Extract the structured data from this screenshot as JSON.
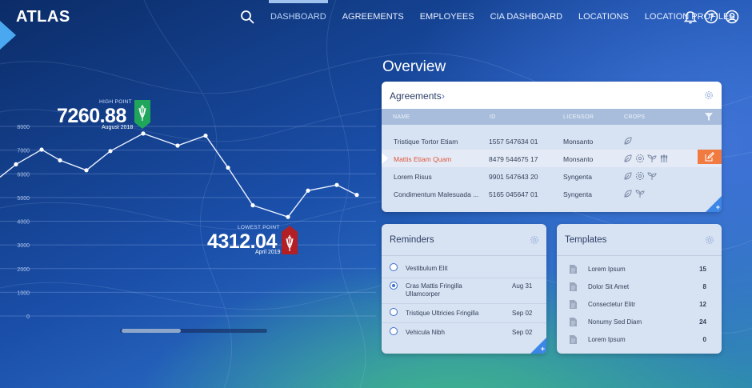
{
  "brand": {
    "name": "ATLAS",
    "accent": "#4aa8f0"
  },
  "nav": {
    "items": [
      {
        "label": "DASHBOARD",
        "active": true
      },
      {
        "label": "AGREEMENTS",
        "active": false
      },
      {
        "label": "EMPLOYEES",
        "active": false
      },
      {
        "label": "CIA DASHBOARD",
        "active": false
      },
      {
        "label": "LOCATIONS",
        "active": false
      },
      {
        "label": "LOCATION PROFILES",
        "active": false
      }
    ],
    "icons": [
      "search-icon",
      "bell-icon",
      "help-icon",
      "user-icon"
    ]
  },
  "chart_data": {
    "type": "line",
    "y_ticks": [
      "8000",
      "7000",
      "6000",
      "5000",
      "4000",
      "3000",
      "2000",
      "1000",
      "0"
    ],
    "ylim": [
      0,
      8000
    ],
    "grid": true,
    "series": [
      {
        "values": [
          6400,
          7020,
          6570,
          6150,
          6960,
          7700,
          7190,
          7610,
          6260,
          4670,
          4180,
          5290,
          5530,
          5110
        ]
      }
    ],
    "high": {
      "label": "HIGH POINT",
      "value": "7260.88",
      "date": "August 2018",
      "color": "#1fa65a"
    },
    "low": {
      "label": "LOWEST POINT",
      "value": "4312.04",
      "date": "April 2019",
      "color": "#b21f24"
    }
  },
  "overview": {
    "title": "Overview",
    "agreements": {
      "title": "Agreements",
      "columns": [
        "NAME",
        "ID",
        "LICENSOR",
        "CROPS"
      ],
      "rows": [
        {
          "name": "Tristique Tortor Etiam",
          "id": "1557 547634 01",
          "licensor": "Monsanto",
          "crops": [
            "leaf-icon"
          ],
          "selected": false
        },
        {
          "name": "Mattis Etiam Quam",
          "id": "8479 544675 17",
          "licensor": "Monsanto",
          "crops": [
            "leaf-icon",
            "flower-icon",
            "sprout-icon",
            "wheat-icon"
          ],
          "selected": true
        },
        {
          "name": "Lorem Risus",
          "id": "9901 547643 20",
          "licensor": "Syngenta",
          "crops": [
            "leaf-icon",
            "flower-icon",
            "sprout-icon"
          ],
          "selected": false
        },
        {
          "name": "Condimentum Malesuada ...",
          "id": "5165 045647 01",
          "licensor": "Syngenta",
          "crops": [
            "leaf-icon",
            "sprout-icon"
          ],
          "selected": false
        }
      ],
      "edit_color": "#f07a3f"
    },
    "reminders": {
      "title": "Reminders",
      "items": [
        {
          "text": "Vestibulum Elit",
          "date": "",
          "checked": false
        },
        {
          "text": "Cras Mattis Fringilla Ullamcorper",
          "date": "Aug 31",
          "checked": true
        },
        {
          "text": "Tristique Ultricies Fringilla",
          "date": "Sep 02",
          "checked": false
        },
        {
          "text": "Vehicula Nibh",
          "date": "Sep 02",
          "checked": false
        }
      ]
    },
    "templates": {
      "title": "Templates",
      "items": [
        {
          "text": "Lorem Ipsum",
          "count": "15"
        },
        {
          "text": "Dolor Sit Amet",
          "count": "8"
        },
        {
          "text": "Consectetur Elitr",
          "count": "12"
        },
        {
          "text": "Nonumy Sed Diam",
          "count": "24"
        },
        {
          "text": "Lorem Ipsum",
          "count": "0"
        }
      ]
    }
  }
}
